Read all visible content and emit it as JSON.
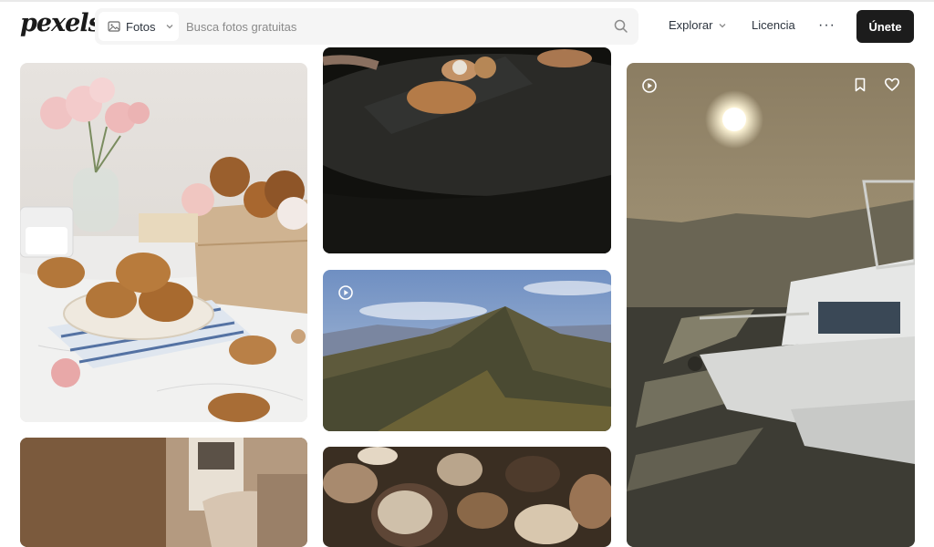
{
  "header": {
    "logo_text": "pexels",
    "filter_label": "Fotos",
    "search_placeholder": "Busca fotos gratuitas",
    "nav_explore": "Explorar",
    "nav_license": "Licencia",
    "more_label": "···",
    "join_label": "Únete"
  },
  "photos": [
    {
      "name": "scones-on-marble",
      "type": "photo"
    },
    {
      "name": "dinner-plate-dark-table",
      "type": "photo"
    },
    {
      "name": "mountain-ridge",
      "type": "video"
    },
    {
      "name": "boat-at-sunset",
      "type": "video"
    },
    {
      "name": "window-chair",
      "type": "photo"
    },
    {
      "name": "seashells",
      "type": "photo"
    }
  ],
  "colors": {
    "accent": "#1c1c1c",
    "search_bg": "#f5f5f5",
    "text": "#2c343e"
  }
}
